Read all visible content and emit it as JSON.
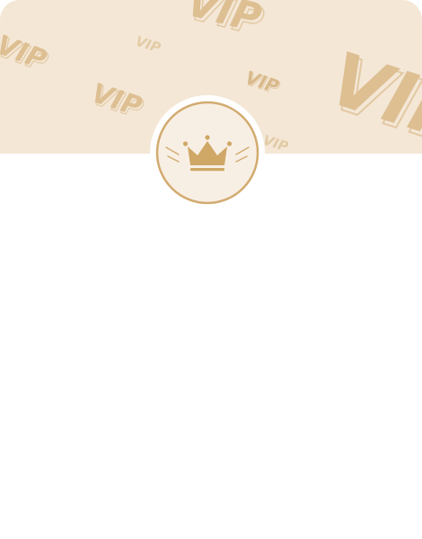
{
  "header": {
    "watermark_word": "VIP",
    "background_color": "#f4e7d6",
    "watermark_color": "#d9b98a"
  },
  "badge": {
    "icon": "crown-icon",
    "ring_color": "#d2ab70",
    "fill_color": "#f8efe4",
    "crown_color": "#cfa766"
  },
  "content": {
    "background_color": "#ffffff"
  }
}
